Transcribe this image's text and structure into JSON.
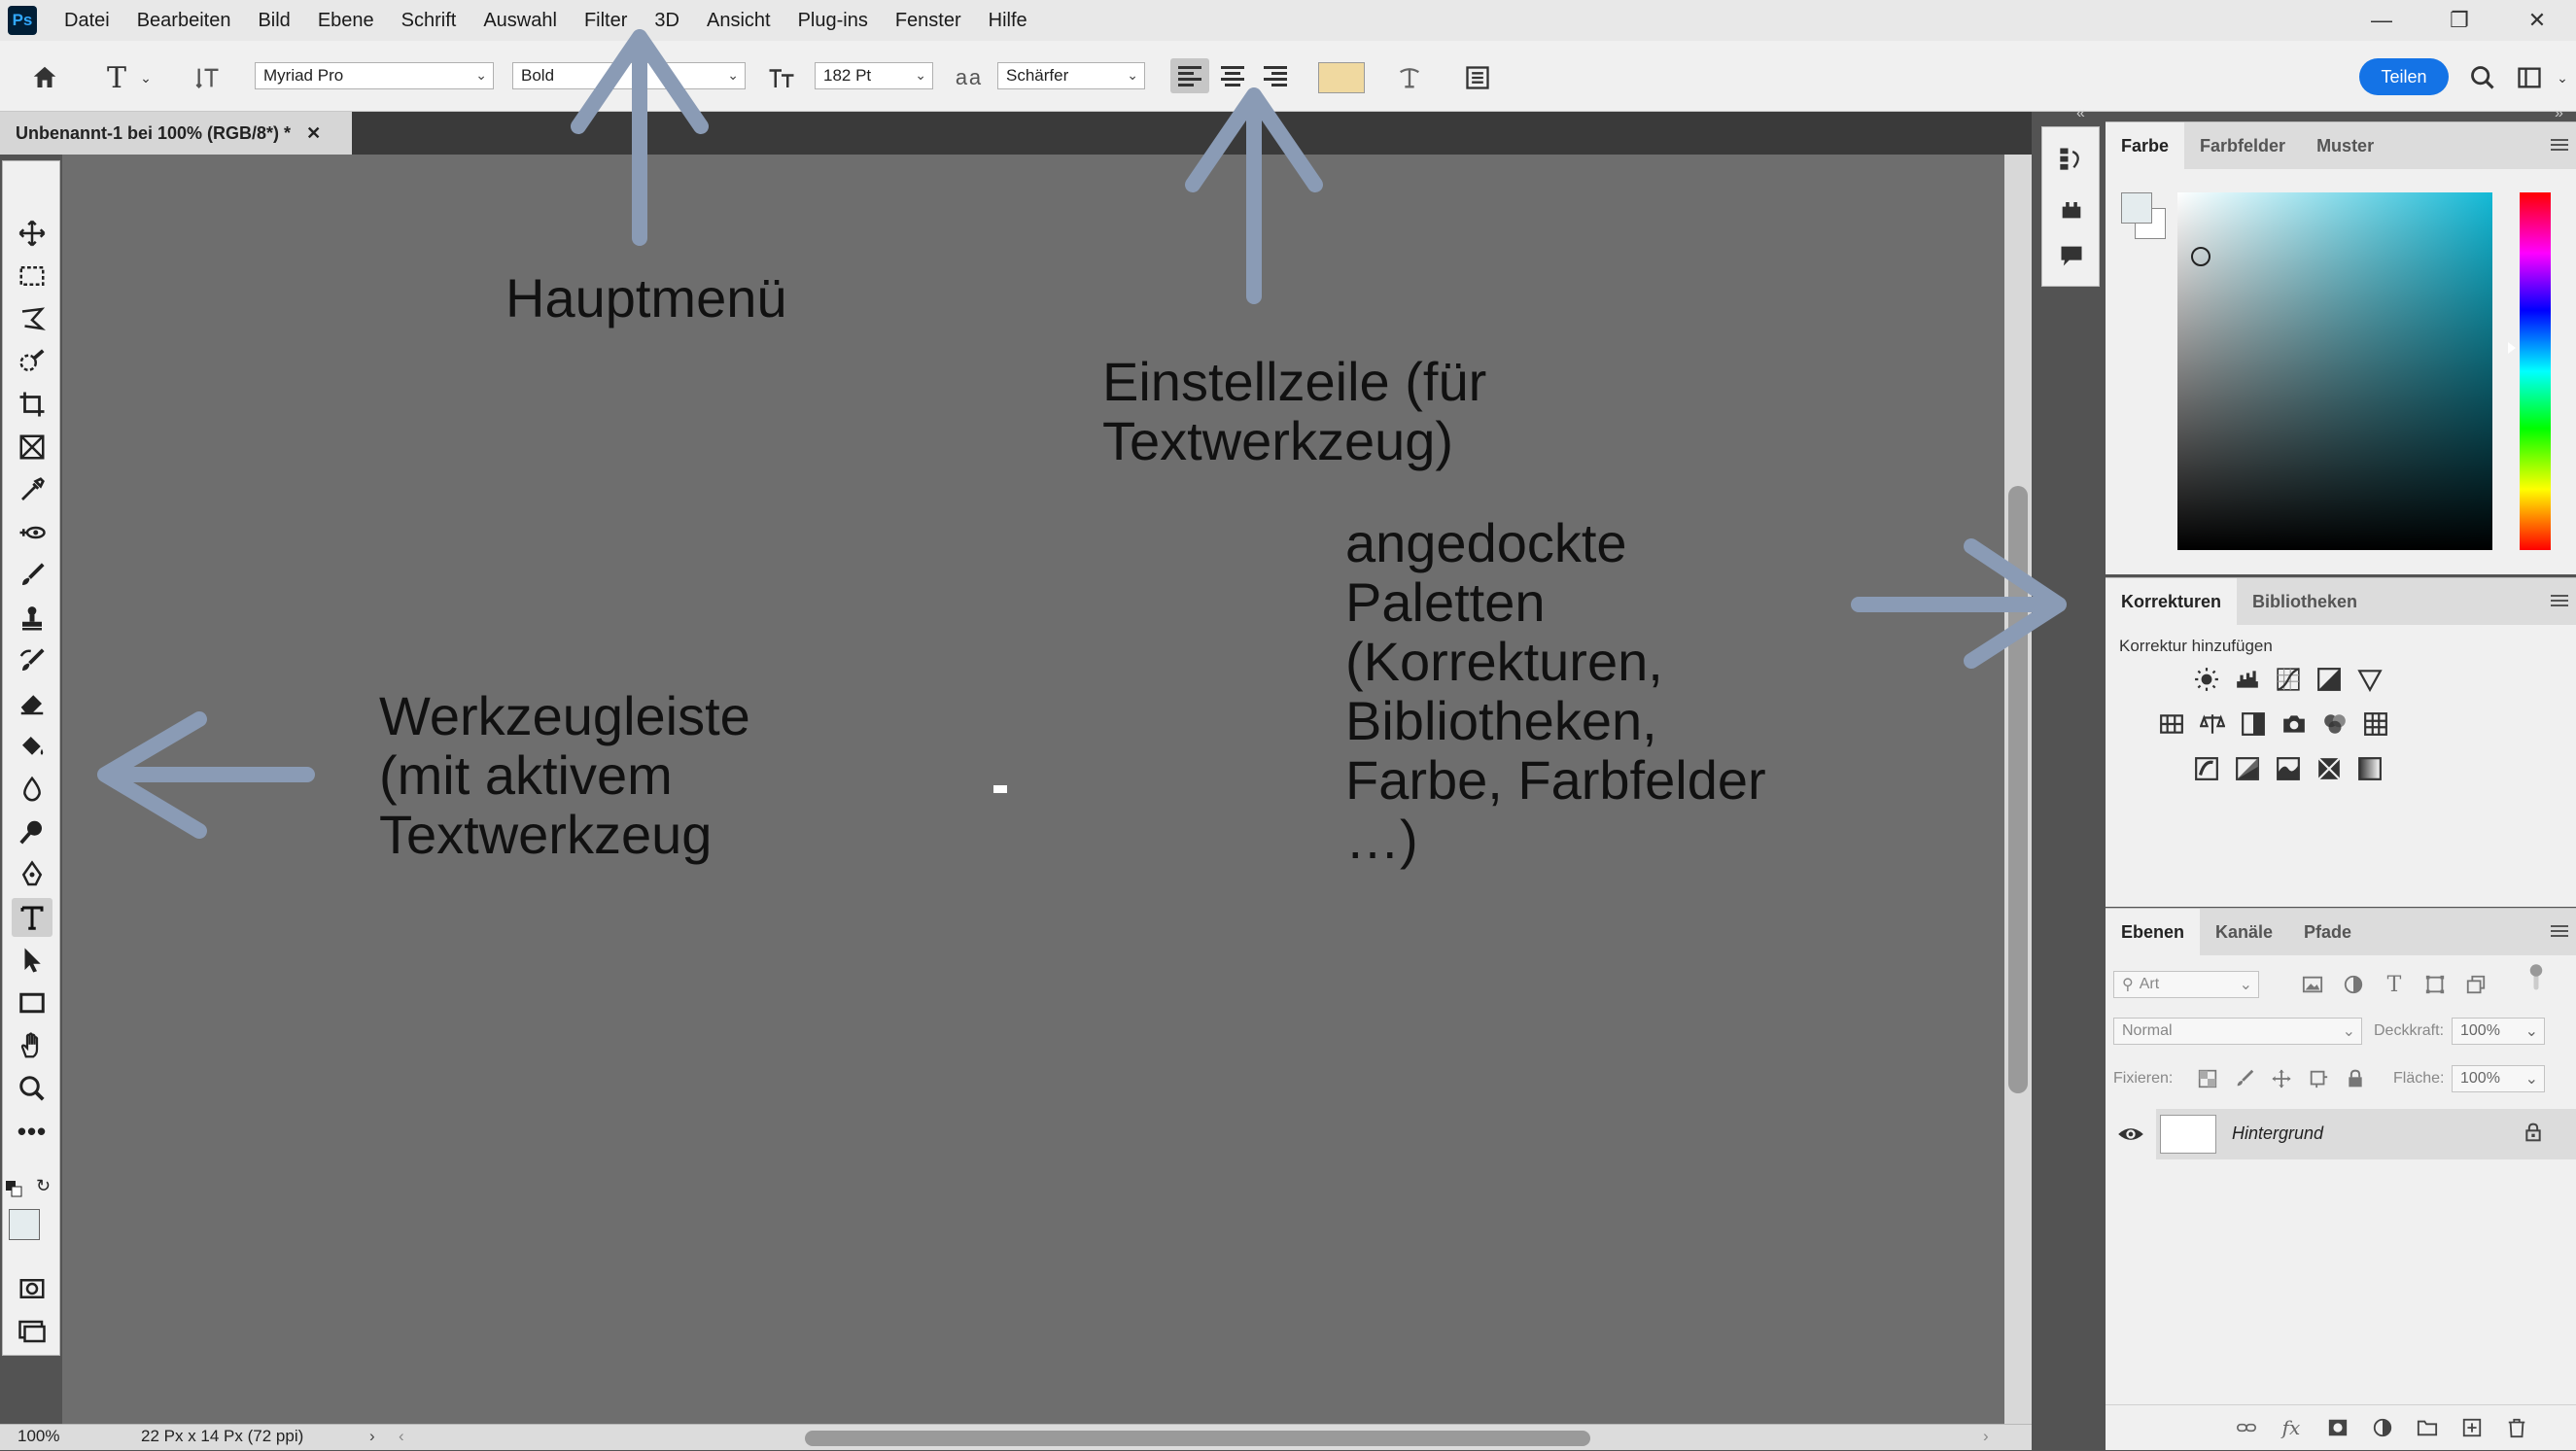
{
  "app": {
    "logo": "Ps"
  },
  "menu": [
    "Datei",
    "Bearbeiten",
    "Bild",
    "Ebene",
    "Schrift",
    "Auswahl",
    "Filter",
    "3D",
    "Ansicht",
    "Plug-ins",
    "Fenster",
    "Hilfe"
  ],
  "options": {
    "font_family": "Myriad Pro",
    "font_style": "Bold",
    "font_size": "182 Pt",
    "antialias": "Schärfer",
    "text_color": "#f0d9a0",
    "share_label": "Teilen"
  },
  "document": {
    "tab_label": "Unbenannt-1 bei 100% (RGB/8*) *",
    "zoom": "100%",
    "info": "22 Px x 14 Px (72 ppi)"
  },
  "panels": {
    "color": {
      "tabs": [
        "Farbe",
        "Farbfelder",
        "Muster"
      ]
    },
    "adjustments": {
      "tabs": [
        "Korrekturen",
        "Bibliotheken"
      ],
      "heading": "Korrektur hinzufügen"
    },
    "layers": {
      "tabs": [
        "Ebenen",
        "Kanäle",
        "Pfade"
      ],
      "filter_placeholder": "Art",
      "blend_mode": "Normal",
      "opacity_label": "Deckkraft:",
      "opacity_value": "100%",
      "lock_label": "Fixieren:",
      "fill_label": "Fläche:",
      "fill_value": "100%",
      "layer_name": "Hintergrund"
    }
  },
  "annotations": {
    "main_menu": "Hauptmenü",
    "options_bar": "Einstellzeile (für\nTextwerkzeug)",
    "panels": "angedockte\nPaletten\n(Korrekturen,\nBibliotheken,\nFarbe, Farbfelder\n…)",
    "toolbar": "Werkzeugleiste\n(mit aktivem\nTextwerkzeug"
  },
  "colors": {
    "accent": "#1473e6",
    "arrow": "#8a9bb5",
    "canvas": "#6e6e6e"
  }
}
